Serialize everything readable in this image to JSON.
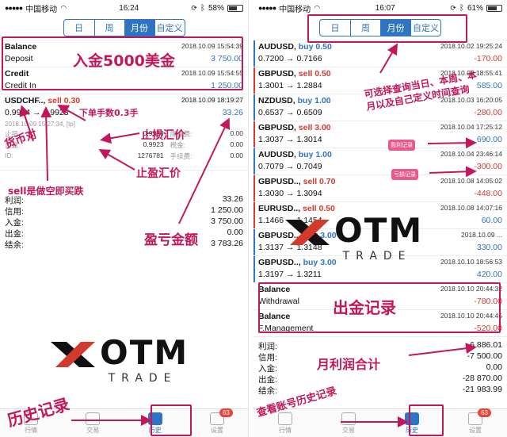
{
  "left": {
    "status": {
      "carrier": "中国移动",
      "time": "16:24",
      "battery": "58%"
    },
    "tabs": [
      "日",
      "周",
      "月份",
      "自定义"
    ],
    "active_tab": 2,
    "deposits": [
      {
        "title": "Balance",
        "date": "2018.10.09 15:54:39",
        "label": "Deposit",
        "amount": "3 750.00"
      },
      {
        "title": "Credit",
        "date": "2018.10.09 15:54:55",
        "label": "Credit In",
        "amount": "1 250.00"
      }
    ],
    "trade": {
      "symbol": "USDCHF..,",
      "side": "sell 0.30",
      "date": "2018.10.09 18:19:27",
      "open_price": "0.9934",
      "close_price": "0.9923",
      "profit": "33.26",
      "meta": "2018.10.09 15:27:34, [tp]",
      "details": [
        {
          "k": "止损:",
          "v": "0.9988",
          "k2": "库存费:",
          "v2": "0.00"
        },
        {
          "k": "止盈:",
          "v": "0.9923",
          "k2": "税金:",
          "v2": "0.00"
        },
        {
          "k": "ID:",
          "v": "1276781",
          "k2": "手续费:",
          "v2": "0.00"
        }
      ]
    },
    "summary": [
      {
        "k": "利润:",
        "v": "33.26"
      },
      {
        "k": "信用:",
        "v": "1 250.00"
      },
      {
        "k": "入金:",
        "v": "3 750.00"
      },
      {
        "k": "出金:",
        "v": "0.00"
      },
      {
        "k": "结余:",
        "v": "3 783.26"
      }
    ],
    "annotations": {
      "deposit": "入金5000美金",
      "lots": "下单手数0.3手",
      "currency_pair": "货币对",
      "sell_note": "sell是做空即买跌",
      "stop_loss": "止损汇价",
      "take_profit": "止盈汇价",
      "pnl": "盈亏金额",
      "history": "历史记录"
    },
    "tabbar": [
      {
        "label": "行情",
        "icon": "quotes-icon"
      },
      {
        "label": "交易",
        "icon": "trade-icon"
      },
      {
        "label": "历史",
        "icon": "history-icon"
      },
      {
        "label": "设置",
        "icon": "settings-icon",
        "badge": "63"
      }
    ]
  },
  "right": {
    "status": {
      "carrier": "中国移动",
      "time": "16:07",
      "battery": "61%"
    },
    "tabs": [
      "日",
      "周",
      "月份",
      "自定义"
    ],
    "active_tab": 2,
    "trades": [
      {
        "symbol": "AUDUSD,",
        "side": "buy 0.50",
        "side_color": "blue",
        "date": "2018.10.02 19:25:24",
        "prices": "0.7200 → 0.7166",
        "profit": "-170.00",
        "profit_color": "red"
      },
      {
        "symbol": "GBPUSD,",
        "side": "sell 0.50",
        "side_color": "red",
        "date": "2018.10.03 18:55:41",
        "prices": "1.3001 → 1.2884",
        "profit": "585.00",
        "profit_color": "blue"
      },
      {
        "symbol": "NZDUSD,",
        "side": "buy 1.00",
        "side_color": "blue",
        "date": "2018.10.03 16:20:05",
        "prices": "0.6537 → 0.6509",
        "profit": "-280.00",
        "profit_color": "red"
      },
      {
        "symbol": "GBPUSD,",
        "side": "sell 3.00",
        "side_color": "red",
        "date": "2018.10.04 17:25:12",
        "prices": "1.3037 → 1.3014",
        "profit": "690.00",
        "profit_color": "blue"
      },
      {
        "symbol": "AUDUSD,",
        "side": "buy 1.00",
        "side_color": "blue",
        "date": "2018.10.04 23:46:14",
        "prices": "0.7079 → 0.7049",
        "profit": "-300.00",
        "profit_color": "red"
      },
      {
        "symbol": "GBPUSD..,",
        "side": "sell 0.70",
        "side_color": "red",
        "date": "2018.10.08 14:05:02",
        "prices": "1.3030 → 1.3094",
        "profit": "-448.00",
        "profit_color": "red"
      },
      {
        "symbol": "EURUSD..,",
        "side": "sell 0.50",
        "side_color": "red",
        "date": "2018.10.08 14:07:16",
        "prices": "1.1466 → 1.1454",
        "profit": "60.00",
        "profit_color": "blue"
      },
      {
        "symbol": "GBPUSD..,",
        "side": "buy 3.00",
        "side_color": "blue",
        "date": "2018.10.09 ...",
        "prices": "1.3137 → 1.3148",
        "profit": "330.00",
        "profit_color": "blue"
      },
      {
        "symbol": "GBPUSD..,",
        "side": "buy 3.00",
        "side_color": "blue",
        "date": "2018.10.10 18:56:53",
        "prices": "1.3197 → 1.3211",
        "profit": "420.00",
        "profit_color": "blue"
      }
    ],
    "withdrawals": [
      {
        "title": "Balance",
        "date": "2018.10.10 20:44:32",
        "label": "Withdrawal",
        "amount": "-780.00"
      },
      {
        "title": "Balance",
        "date": "2018.10.10 20:44:45",
        "label": "F.Management",
        "amount": "-520.00"
      }
    ],
    "summary": [
      {
        "k": "利润:",
        "v": "6 886.01"
      },
      {
        "k": "信用:",
        "v": "-7 500.00"
      },
      {
        "k": "入金:",
        "v": "0.00"
      },
      {
        "k": "出金:",
        "v": "-28 870.00"
      },
      {
        "k": "结余:",
        "v": "-21 983.99"
      }
    ],
    "annotations": {
      "range_query": "可选择查询当日、本周、本月以及自己定义时间查询",
      "profit_tag": "盈利记录",
      "loss_tag": "亏损记录",
      "withdraw": "出金记录",
      "monthly_profit": "月利润合计",
      "view_history": "查看账号历史记录"
    },
    "tabbar": [
      {
        "label": "行情",
        "icon": "quotes-icon"
      },
      {
        "label": "交易",
        "icon": "trade-icon"
      },
      {
        "label": "历史",
        "icon": "history-icon"
      },
      {
        "label": "设置",
        "icon": "settings-icon",
        "badge": "63"
      }
    ]
  },
  "logo": {
    "word": "OTM",
    "sub": "TRADE"
  },
  "colors": {
    "accent": "#2f74c0",
    "loss": "#d33a2c",
    "annotation": "#c2185b"
  }
}
